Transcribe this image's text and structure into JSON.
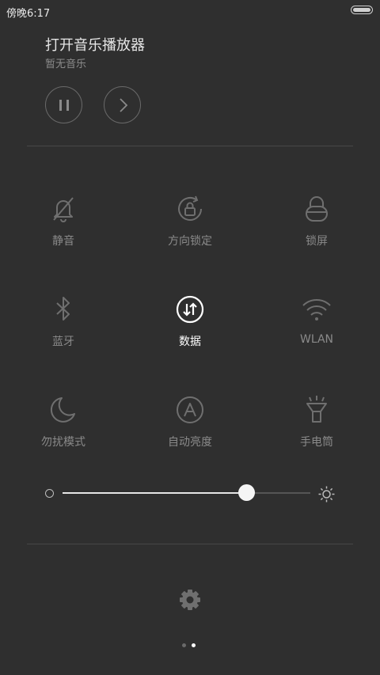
{
  "status": {
    "time": "傍晚6:17"
  },
  "music": {
    "title": "打开音乐播放器",
    "subtitle": "暂无音乐"
  },
  "toggles": [
    {
      "label": "静音",
      "icon": "bell-off-icon",
      "active": false
    },
    {
      "label": "方向锁定",
      "icon": "rotation-lock-icon",
      "active": false
    },
    {
      "label": "锁屏",
      "icon": "lock-icon",
      "active": false
    },
    {
      "label": "蓝牙",
      "icon": "bluetooth-icon",
      "active": false
    },
    {
      "label": "数据",
      "icon": "mobile-data-icon",
      "active": true
    },
    {
      "label": "WLAN",
      "icon": "wifi-icon",
      "active": false
    },
    {
      "label": "勿扰模式",
      "icon": "moon-icon",
      "active": false
    },
    {
      "label": "自动亮度",
      "icon": "auto-brightness-icon",
      "active": false
    },
    {
      "label": "手电筒",
      "icon": "flashlight-icon",
      "active": false
    }
  ],
  "brightness": {
    "level": 0.74
  },
  "pager": {
    "count": 2,
    "active_index": 1
  },
  "colors": {
    "background": "#2f2f2f",
    "icon": "#6f6f6f",
    "active": "#ffffff"
  }
}
